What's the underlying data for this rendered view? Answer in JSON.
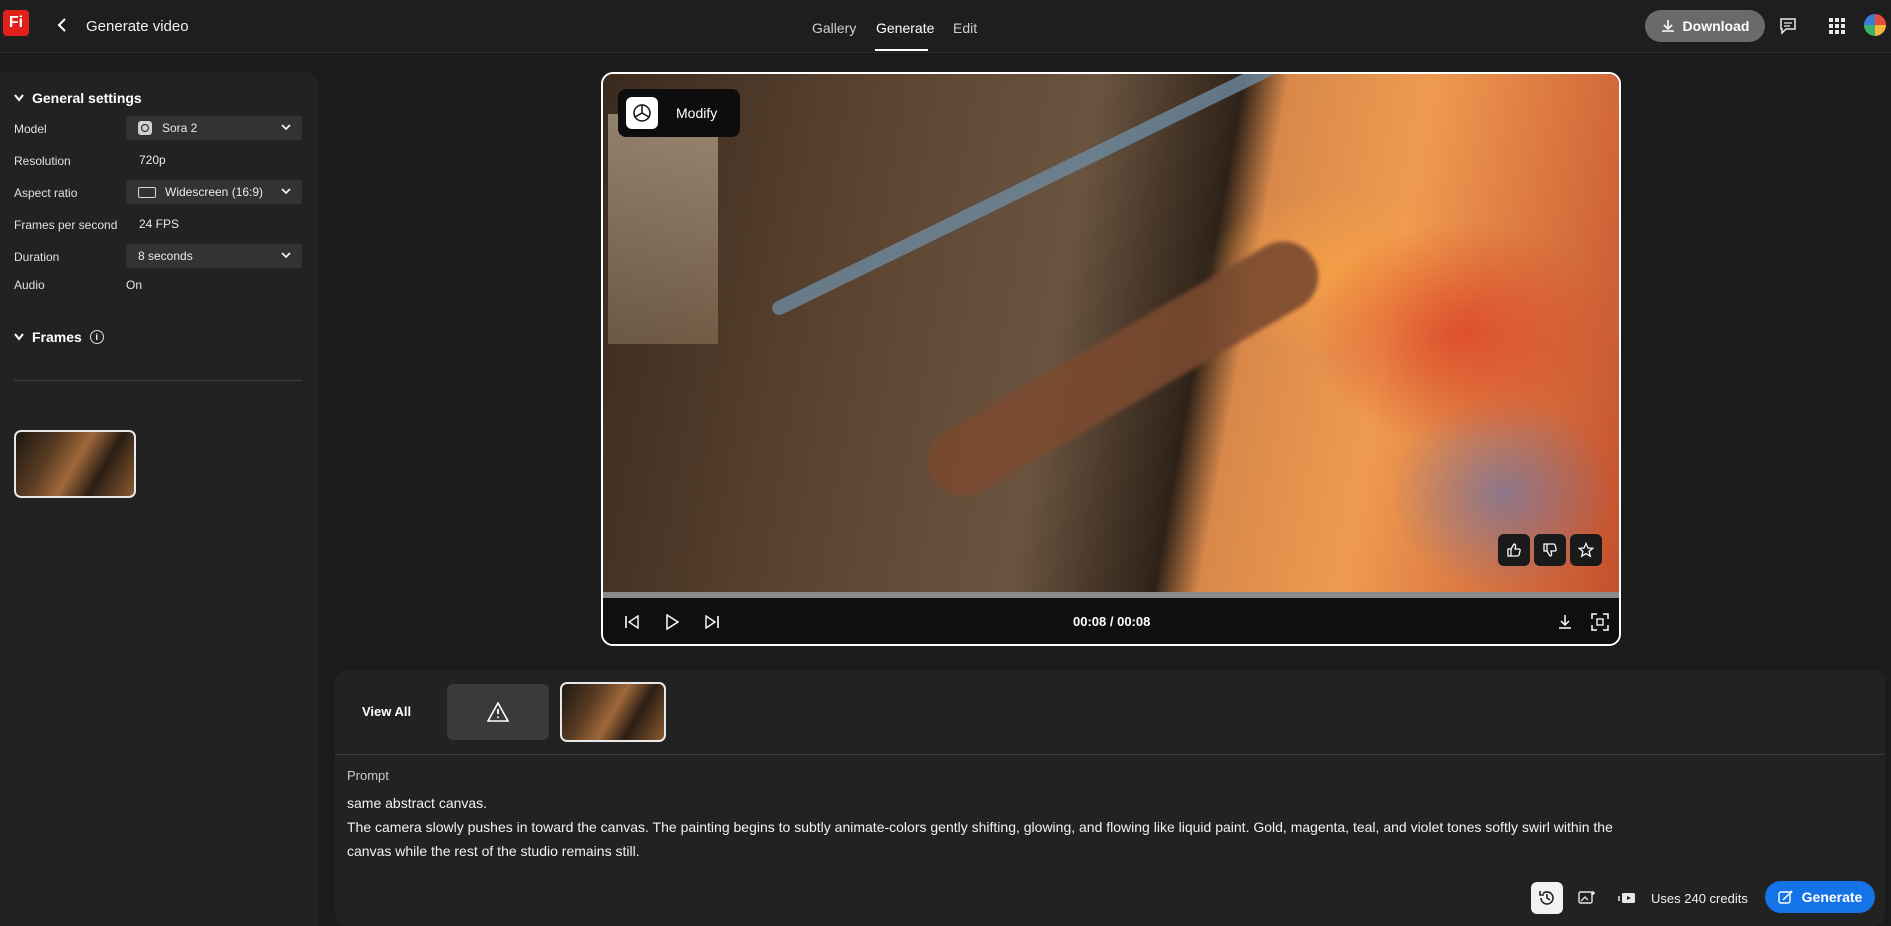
{
  "app": {
    "logo_text": "Fi",
    "title": "Generate video"
  },
  "nav": {
    "tabs": [
      {
        "label": "Gallery",
        "active": false
      },
      {
        "label": "Generate",
        "active": true
      },
      {
        "label": "Edit",
        "active": false
      }
    ]
  },
  "header": {
    "download_label": "Download",
    "icons": [
      "comment-icon",
      "apps-grid-icon",
      "avatar"
    ]
  },
  "sidebar": {
    "general_settings_title": "General settings",
    "settings": {
      "model_label": "Model",
      "model_value": "Sora 2",
      "resolution_label": "Resolution",
      "resolution_value": "720p",
      "aspect_label": "Aspect ratio",
      "aspect_value": "Widescreen (16:9)",
      "fps_label": "Frames per second",
      "fps_value": "24 FPS",
      "duration_label": "Duration",
      "duration_value": "8 seconds",
      "audio_label": "Audio",
      "audio_value": "On"
    },
    "frames_title": "Frames"
  },
  "player": {
    "modify_label": "Modify",
    "time_readout": "00:08 / 00:08",
    "progress_fraction": 1.0
  },
  "bottom": {
    "view_all_label": "View All",
    "prompt_label": "Prompt",
    "prompt_lines": [
      "same abstract canvas.",
      "The camera slowly pushes in toward the canvas. The painting begins to subtly animate-colors gently shifting, glowing, and flowing like liquid paint. Gold, magenta, teal, and violet tones softly swirl within the",
      "canvas while the rest of the studio remains still."
    ],
    "credits_text": "Uses 240 credits",
    "generate_label": "Generate"
  },
  "colors": {
    "accent": "#1473e6",
    "brand": "#e0211b",
    "background": "#1b1b1b",
    "panel": "#222222"
  }
}
